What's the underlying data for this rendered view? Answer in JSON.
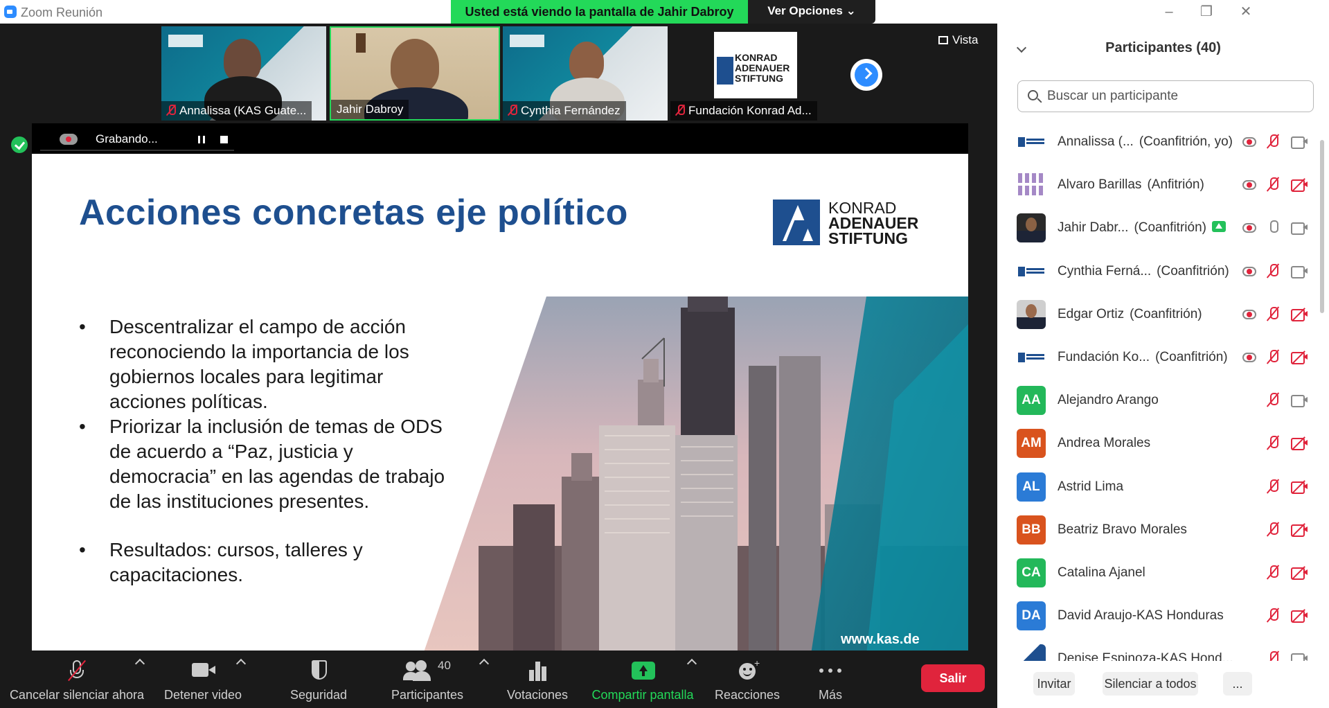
{
  "window": {
    "title": "Zoom Reunión",
    "share_banner": "Usted está viendo la pantalla de Jahir Dabroy",
    "view_options": "Ver Opciones ⌄"
  },
  "view_button": "Vista",
  "thumbnails": [
    {
      "name": "Annalissa (KAS Guate...",
      "muted": true
    },
    {
      "name": "Jahir Dabroy",
      "muted": false
    },
    {
      "name": "Cynthia Fernández",
      "muted": true
    },
    {
      "name": "Fundación Konrad Ad...",
      "muted": true
    }
  ],
  "recording": {
    "label": "Grabando..."
  },
  "slide": {
    "title": "Acciones concretas eje político",
    "logo_lines": [
      "KONRAD",
      "ADENAUER",
      "STIFTUNG"
    ],
    "bullets": [
      "Descentralizar el campo de acción reconociendo la importancia de los gobiernos locales para legitimar acciones políticas.",
      "Priorizar la inclusión de temas de ODS de acuerdo a “Paz, justicia y democracia” en las agendas de trabajo de las instituciones presentes.",
      "Resultados:  cursos, talleres y capacitaciones."
    ],
    "website": "www.kas.de"
  },
  "toolbar": {
    "mute": "Cancelar silenciar ahora",
    "video": "Detener video",
    "security": "Seguridad",
    "participants": "Participantes",
    "participants_count": "40",
    "polls": "Votaciones",
    "share": "Compartir pantalla",
    "reactions": "Reacciones",
    "more": "Más",
    "leave": "Salir"
  },
  "panel": {
    "title": "Participantes (40)",
    "search_placeholder": "Buscar un participante",
    "participants": [
      {
        "name": "Annalissa (...",
        "role": "(Coanfitrión, yo)",
        "avatar_type": "kas",
        "rec": true,
        "mic": "off",
        "video": "on"
      },
      {
        "name": "Alvaro Barillas",
        "role": "(Anfitrión)",
        "avatar_type": "purple",
        "rec": true,
        "mic": "off",
        "video": "off"
      },
      {
        "name": "Jahir Dabr...",
        "role": "(Coanfitrión)",
        "avatar_type": "photo",
        "share": true,
        "rec": true,
        "mic": "on",
        "video": "on"
      },
      {
        "name": "Cynthia Ferná...",
        "role": "(Coanfitrión)",
        "avatar_type": "kas",
        "rec": true,
        "mic": "off",
        "video": "on"
      },
      {
        "name": "Edgar Ortiz",
        "role": "(Coanfitrión)",
        "avatar_type": "photo2",
        "rec": true,
        "mic": "off",
        "video": "off"
      },
      {
        "name": "Fundación Ko...",
        "role": "(Coanfitrión)",
        "avatar_type": "kas",
        "rec": true,
        "mic": "off",
        "video": "off"
      },
      {
        "name": "Alejandro Arango",
        "role": "",
        "avatar_type": "initials",
        "initials": "AA",
        "color": "#23b85a",
        "rec": false,
        "mic": "off",
        "video": "on"
      },
      {
        "name": "Andrea Morales",
        "role": "",
        "avatar_type": "initials",
        "initials": "AM",
        "color": "#d9531e",
        "rec": false,
        "mic": "off",
        "video": "off"
      },
      {
        "name": "Astrid Lima",
        "role": "",
        "avatar_type": "initials",
        "initials": "AL",
        "color": "#2b7bd6",
        "rec": false,
        "mic": "off",
        "video": "off"
      },
      {
        "name": "Beatriz Bravo Morales",
        "role": "",
        "avatar_type": "initials",
        "initials": "BB",
        "color": "#d9531e",
        "rec": false,
        "mic": "off",
        "video": "off"
      },
      {
        "name": "Catalina Ajanel",
        "role": "",
        "avatar_type": "initials",
        "initials": "CA",
        "color": "#23b85a",
        "rec": false,
        "mic": "off",
        "video": "off"
      },
      {
        "name": "David Araujo-KAS Honduras",
        "role": "",
        "avatar_type": "initials",
        "initials": "DA",
        "color": "#2b7bd6",
        "rec": false,
        "mic": "off",
        "video": "off"
      },
      {
        "name": "Denise Espinoza-KAS Hond...",
        "role": "",
        "avatar_type": "kasblue",
        "rec": false,
        "mic": "off",
        "video": "on"
      }
    ],
    "footer": {
      "invite": "Invitar",
      "mute_all": "Silenciar a todos",
      "more": "..."
    }
  },
  "colors": {
    "accent": "#2d8cff",
    "share_green": "#23d959",
    "danger": "#e0243c",
    "kas_blue": "#1e4f8f"
  }
}
